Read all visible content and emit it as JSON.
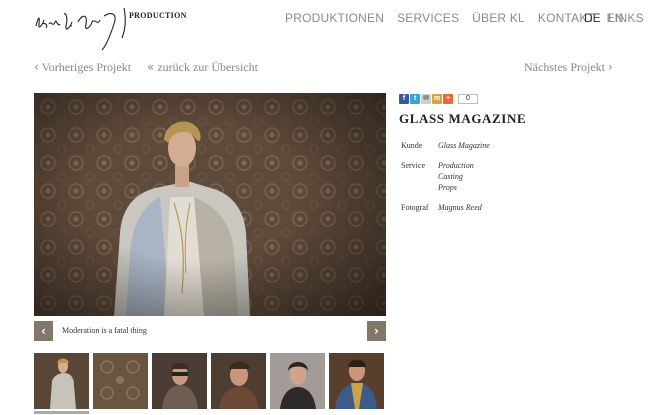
{
  "header": {
    "logo_word": "PRODUCTION",
    "nav": [
      "PRODUKTIONEN",
      "SERVICES",
      "ÜBER KL",
      "KONTAKT",
      "LINKS"
    ],
    "languages": [
      "DE",
      "EN"
    ],
    "active_language": "DE"
  },
  "project_nav": {
    "prev_label": "Vorheriges Projekt",
    "overview_label": "zurück zur Übersicht",
    "next_label": "Nächstes Projekt"
  },
  "gallery": {
    "caption": "Moderation is a fatal thing",
    "thumbnail_count": 6,
    "active_thumbnail": 1
  },
  "share": {
    "icons": [
      "facebook-icon",
      "twitter-icon",
      "email-icon",
      "myspace-icon",
      "plus-icon"
    ],
    "count": "0"
  },
  "project": {
    "title": "GLASS MAGAZINE",
    "details": [
      {
        "label": "Kunde",
        "values": [
          "Glass Magazine"
        ]
      },
      {
        "label": "Service",
        "values": [
          "Production",
          "Casting",
          "Props"
        ]
      },
      {
        "label": "Fotograf",
        "values": [
          "Magnus Reed"
        ]
      }
    ]
  },
  "colors": {
    "arrow_button": "#827868",
    "nav_text": "#8a8a8a",
    "wallpaper": "#5a4636"
  }
}
